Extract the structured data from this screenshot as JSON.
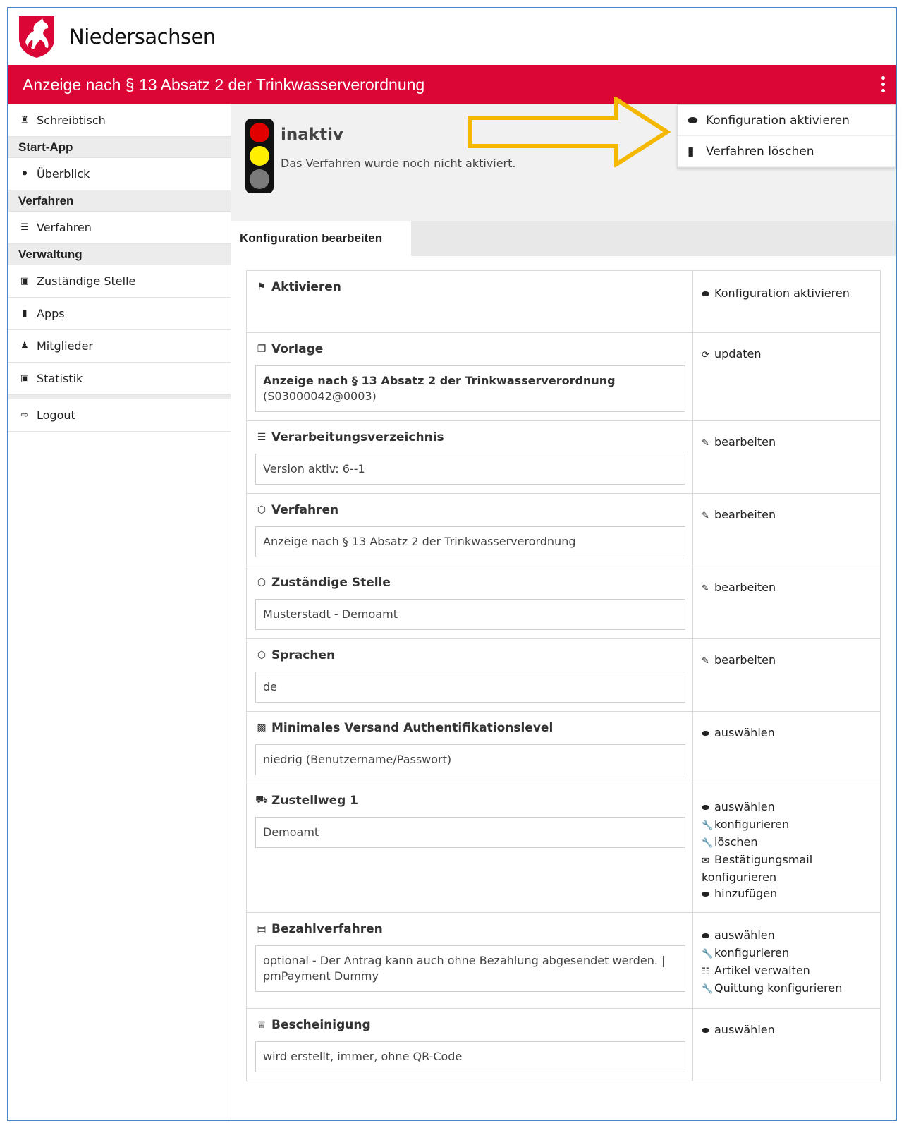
{
  "brand": {
    "name": "Niedersachsen",
    "logo_icon": "horse-crest-icon"
  },
  "header": {
    "title": "Anzeige nach § 13 Absatz 2 der Trinkwasserverordnung",
    "bg_color": "#db0536"
  },
  "sidebar": {
    "home": {
      "label": "Schreibtisch",
      "icon": "home-icon"
    },
    "sections": [
      {
        "heading": "Start-App",
        "items": [
          {
            "label": "Überblick",
            "icon": "pin-icon"
          }
        ]
      },
      {
        "heading": "Verfahren",
        "items": [
          {
            "label": "Verfahren",
            "icon": "list-icon"
          }
        ]
      },
      {
        "heading": "Verwaltung",
        "items": [
          {
            "label": "Zuständige Stelle",
            "icon": "building-icon"
          },
          {
            "label": "Apps",
            "icon": "book-icon"
          },
          {
            "label": "Mitglieder",
            "icon": "users-icon"
          },
          {
            "label": "Statistik",
            "icon": "chart-icon"
          }
        ]
      }
    ],
    "logout": {
      "label": "Logout",
      "icon": "logout-icon"
    }
  },
  "status": {
    "title": "inaktiv",
    "subtitle": "Das Verfahren wurde noch nicht aktiviert."
  },
  "actions_menu": [
    {
      "label": "Konfiguration aktivieren",
      "icon": "toggle-icon"
    },
    {
      "label": "Verfahren löschen",
      "icon": "trash-icon"
    }
  ],
  "tab": {
    "label": "Konfiguration bearbeiten"
  },
  "config": {
    "aktivieren": {
      "title": "Aktivieren",
      "action": "Konfiguration aktivieren"
    },
    "vorlage": {
      "title": "Vorlage",
      "value_line1": "Anzeige nach § 13 Absatz 2 der Trinkwasserverordnung",
      "value_line2": "(S03000042@0003)",
      "action": "updaten"
    },
    "verarbeitung": {
      "title": "Verarbeitungsverzeichnis",
      "value": "Version aktiv: 6--1",
      "action": "bearbeiten"
    },
    "verfahren": {
      "title": "Verfahren",
      "value": "Anzeige nach § 13 Absatz 2 der Trinkwasserverordnung",
      "action": "bearbeiten"
    },
    "stelle": {
      "title": "Zuständige Stelle",
      "value": "Musterstadt - Demoamt",
      "action": "bearbeiten"
    },
    "sprachen": {
      "title": "Sprachen",
      "value": "de",
      "action": "bearbeiten"
    },
    "auth": {
      "title": "Minimales Versand Authentifikationslevel",
      "value": "niedrig (Benutzername/Passwort)",
      "action": "auswählen"
    },
    "zustellweg": {
      "title": "Zustellweg 1",
      "value": "Demoamt",
      "actions": {
        "select": "auswählen",
        "configure": "konfigurieren",
        "delete": "löschen",
        "mail": "Bestätigungsmail konfigurieren",
        "add": "hinzufügen"
      }
    },
    "bezahl": {
      "title": "Bezahlverfahren",
      "value": "optional - Der Antrag kann auch ohne Bezahlung abgesendet werden. | pmPayment Dummy",
      "actions": {
        "select": "auswählen",
        "configure": "konfigurieren",
        "articles": "Artikel verwalten",
        "receipt": "Quittung konfigurieren"
      }
    },
    "bescheinigung": {
      "title": "Bescheinigung",
      "value": "wird erstellt, immer, ohne QR-Code",
      "action": "auswählen"
    }
  },
  "annotation_arrow_color": "#f5b800"
}
